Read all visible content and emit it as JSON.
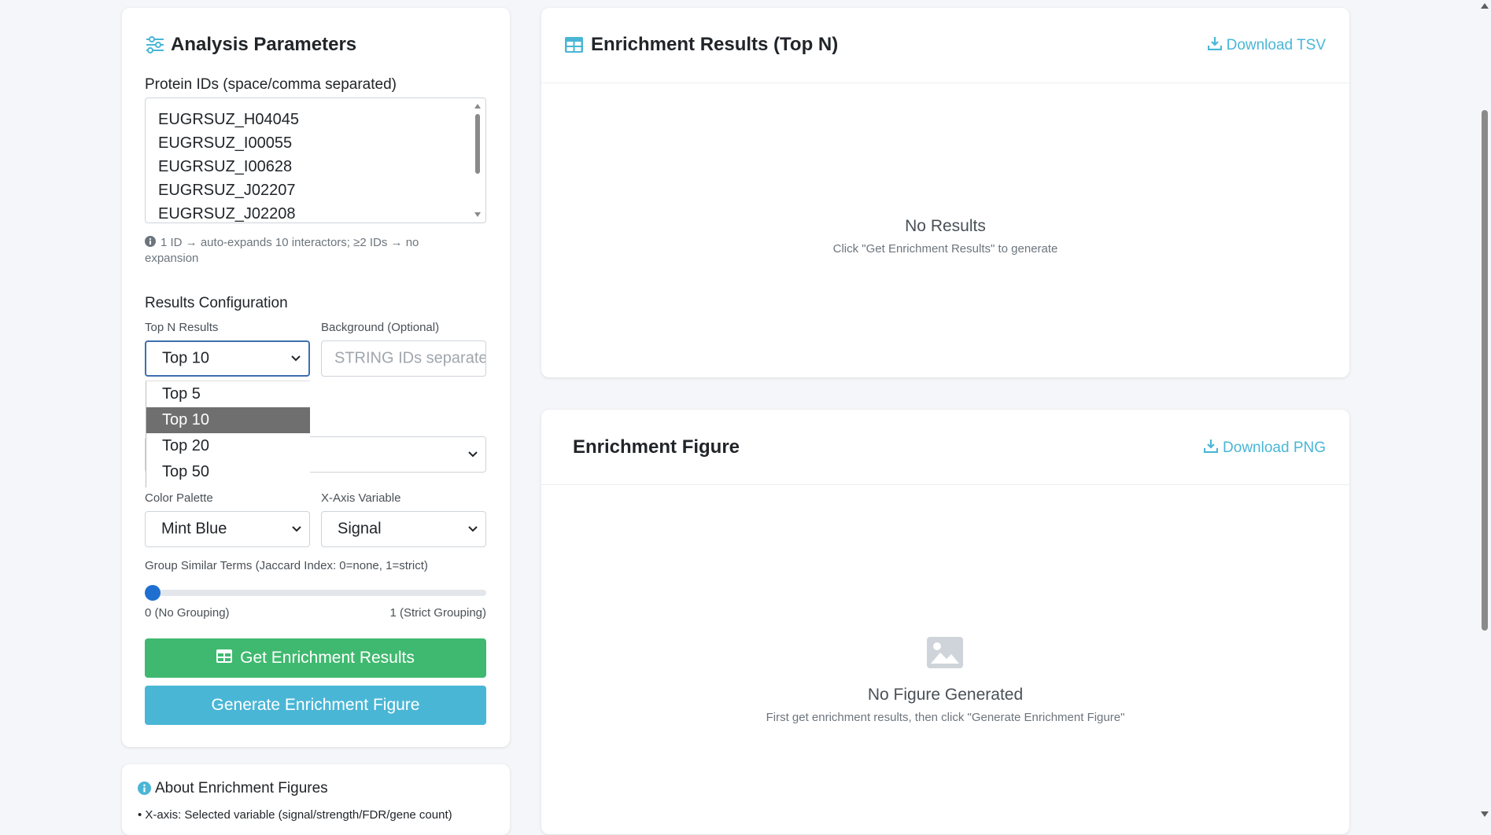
{
  "params": {
    "title": "Analysis Parameters",
    "protein_label": "Protein IDs (space/comma separated)",
    "protein_ids": [
      "EUGRSUZ_H04045",
      "EUGRSUZ_I00055",
      "EUGRSUZ_I00628",
      "EUGRSUZ_J02207",
      "EUGRSUZ_J02208"
    ],
    "hint": "1 ID → auto-expands 10 interactors; ≥2 IDs → no expansion",
    "config_heading": "Results Configuration",
    "topn_label": "Top N Results",
    "topn_value": "Top 10",
    "topn_options": [
      "Top 5",
      "Top 10",
      "Top 20",
      "Top 50"
    ],
    "background_label": "Background (Optional)",
    "background_placeholder": "STRING IDs separated",
    "palette_label": "Color Palette",
    "palette_value": "Mint Blue",
    "xaxis_label": "X-Axis Variable",
    "xaxis_value": "Signal",
    "group_label": "Group Similar Terms (Jaccard Index: 0=none, 1=strict)",
    "slider_value": 0,
    "slider_min_label": "0 (No Grouping)",
    "slider_max_label": "1 (Strict Grouping)",
    "get_button": "Get Enrichment Results",
    "figure_button": "Generate Enrichment Figure"
  },
  "about": {
    "title": "About Enrichment Figures",
    "line1": "• X-axis: Selected variable (signal/strength/FDR/gene count)"
  },
  "results": {
    "title": "Enrichment Results (Top N)",
    "download": "Download TSV",
    "empty_title": "No Results",
    "empty_sub": "Click \"Get Enrichment Results\" to generate"
  },
  "figure": {
    "title": "Enrichment Figure",
    "download": "Download PNG",
    "empty_title": "No Figure Generated",
    "empty_sub": "First get enrichment results, then click \"Generate Enrichment Figure\""
  },
  "colors": {
    "accent": "#4ab6d6",
    "success": "#3fb96f",
    "select_focus": "#3d6fb0"
  }
}
